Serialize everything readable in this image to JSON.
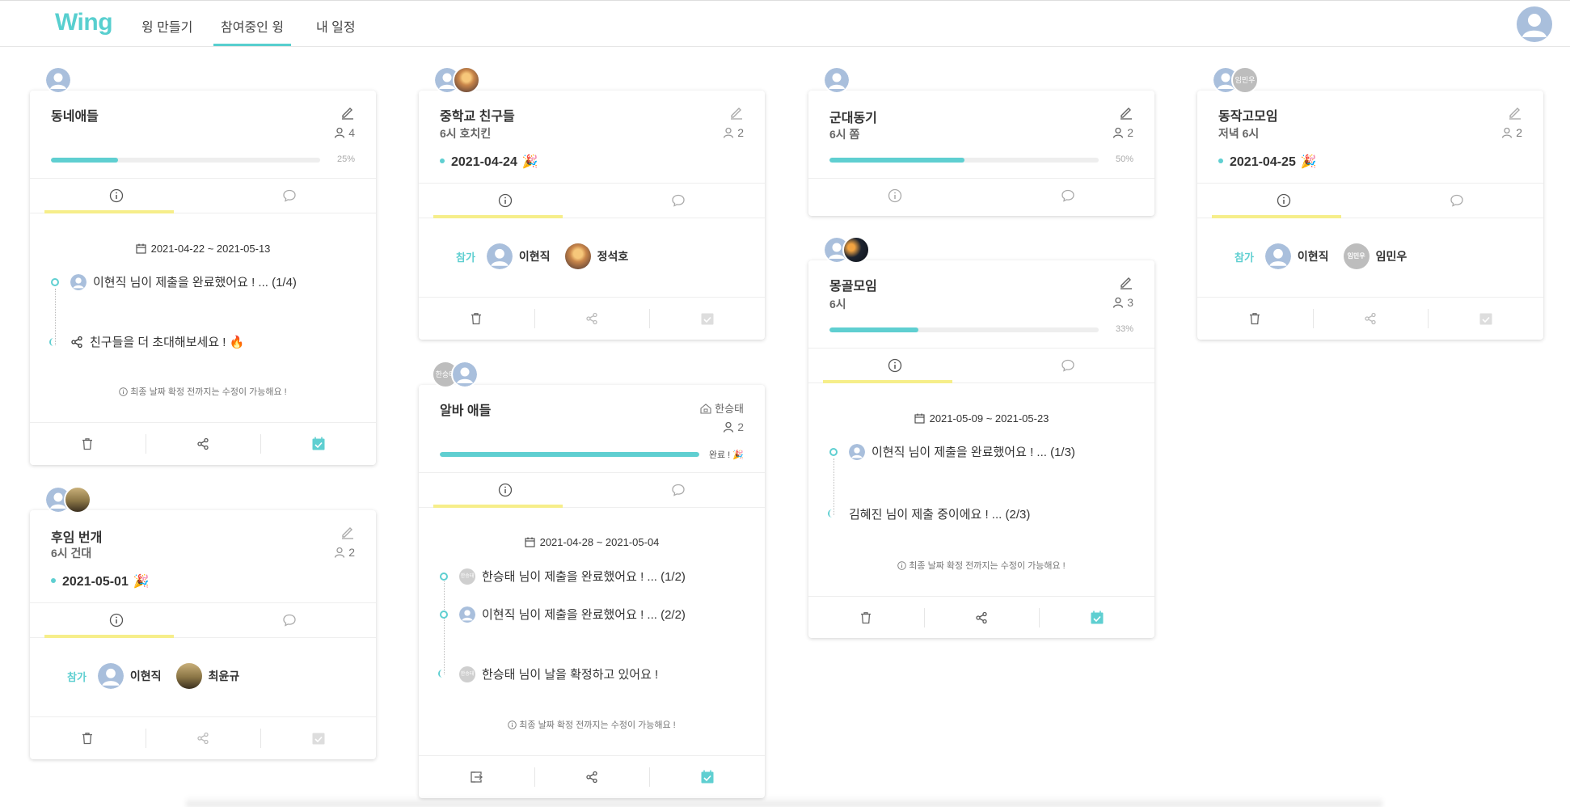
{
  "app": {
    "logo": "Wing"
  },
  "nav": {
    "items": [
      {
        "label": "윙 만들기"
      },
      {
        "label": "참여중인 윙"
      },
      {
        "label": "내 일정"
      }
    ],
    "active": "참여중인 윙"
  },
  "colors": {
    "accent": "#5fcfd1",
    "tab_underline": "#f6ee8a"
  },
  "cards": {
    "c1": {
      "title": "동네애들",
      "members": "4",
      "progress_pct": 25,
      "progress_label": "25%",
      "period": "2021-04-22 ~ 2021-05-13",
      "tl1": "이현직 님이 제출을 완료했어요 ! ... (1/4)",
      "tl2": "친구들을 더 초대해보세요 ! 🔥",
      "note": "최종 날짜 확정 전까지는 수정이 가능해요 !"
    },
    "c2": {
      "title": "후임 번개",
      "subtitle": "6시 건대",
      "members": "2",
      "date": "2021-05-01",
      "party": "🎉",
      "join_label": "참가",
      "p1": "이현직",
      "p2": "최윤규"
    },
    "c3": {
      "title": "중학교 친구들",
      "subtitle": "6시 호치킨",
      "members": "2",
      "date": "2021-04-24",
      "party": "🎉",
      "join_label": "참가",
      "p1": "이현직",
      "p2": "정석호"
    },
    "c4": {
      "title": "알바 애들",
      "owner": "한승태",
      "members": "2",
      "progress_pct": 100,
      "done_label": "완료 ! 🎉",
      "avatar_text": "한승태",
      "period": "2021-04-28 ~ 2021-05-04",
      "tl1": "한승태 님이 제출을 완료했어요 ! ... (1/2)",
      "tl2": "이현직 님이 제출을 완료했어요 ! ... (2/2)",
      "tl3": "한승태 님이 날을 확정하고 있어요 !",
      "note": "최종 날짜 확정 전까지는 수정이 가능해요 !"
    },
    "c5": {
      "title": "군대동기",
      "subtitle": "6시 쫌",
      "members": "2",
      "progress_pct": 50,
      "progress_label": "50%"
    },
    "c6": {
      "title": "몽골모임",
      "subtitle": "6시",
      "members": "3",
      "progress_pct": 33,
      "progress_label": "33%",
      "period": "2021-05-09 ~ 2021-05-23",
      "tl1": "이현직 님이 제출을 완료했어요 ! ... (1/3)",
      "tl2": "김혜진 님이 제출 중이에요 ! ... (2/3)",
      "note": "최종 날짜 확정 전까지는 수정이 가능해요 !"
    },
    "c7": {
      "title": "동작고모임",
      "subtitle": "저녁 6시",
      "members": "2",
      "date": "2021-04-25",
      "party": "🎉",
      "avatar_text": "임민우",
      "join_label": "참가",
      "p1": "이현직",
      "p2": "임민우"
    }
  }
}
